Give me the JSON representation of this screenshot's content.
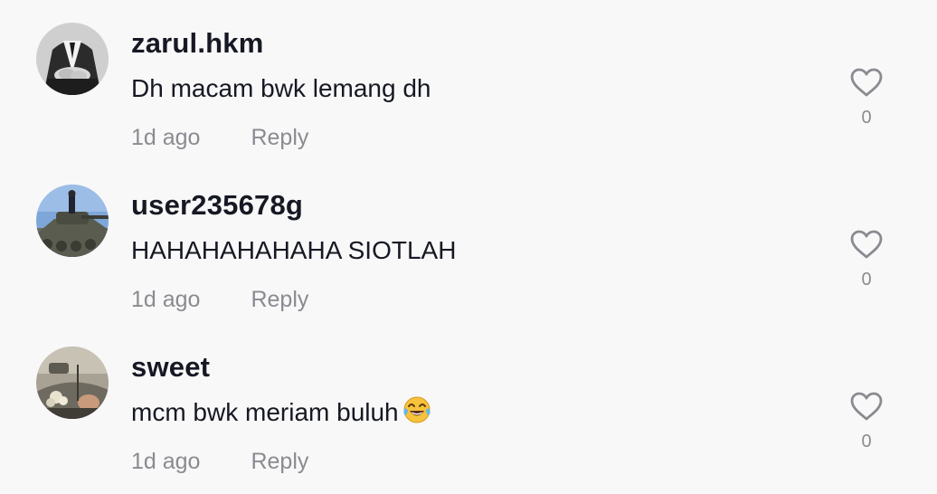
{
  "comments": [
    {
      "username": "zarul.hkm",
      "text": "Dh macam bwk lemang dh",
      "time": "1d ago",
      "reply_label": "Reply",
      "likes": "0",
      "avatar": "avatar-dark-suit-hands"
    },
    {
      "username": "user235678g",
      "text": "HAHAHAHAHAHA SIOTLAH",
      "time": "1d ago",
      "reply_label": "Reply",
      "likes": "0",
      "avatar": "avatar-person-on-tank"
    },
    {
      "username": "sweet",
      "text": "mcm bwk meriam buluh",
      "emoji": "😂",
      "time": "1d ago",
      "reply_label": "Reply",
      "likes": "0",
      "avatar": "avatar-car-interior-flowers"
    }
  ],
  "colors": {
    "background": "#f8f8f8",
    "text_primary": "#161823",
    "text_secondary": "#8a8b91"
  },
  "icons": {
    "like": "heart-outline-icon"
  }
}
